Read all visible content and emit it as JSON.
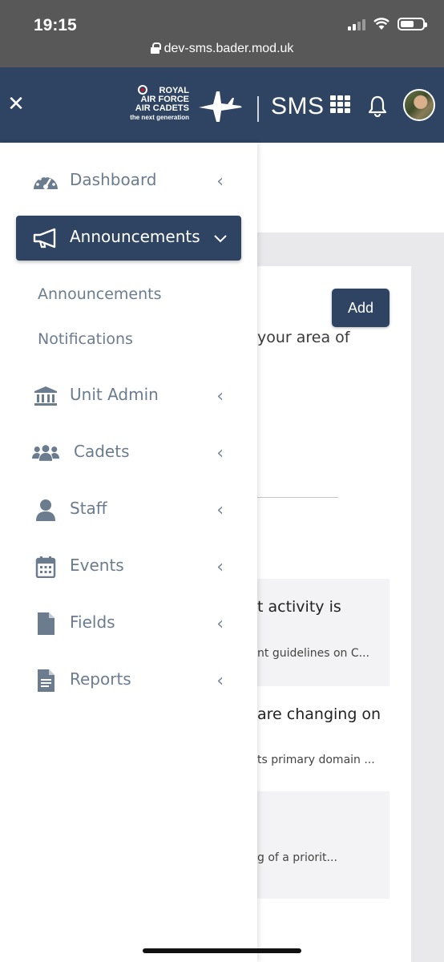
{
  "status_bar": {
    "time": "19:15",
    "url": "dev-sms.bader.mod.uk"
  },
  "header": {
    "brand_lines": [
      "ROYAL",
      "AIR FORCE",
      "AIR CADETS",
      "the next generation"
    ],
    "app_name": "SMS"
  },
  "sidebar": {
    "items": [
      {
        "label": "Dashboard",
        "icon": "dashboard-gauge-icon"
      },
      {
        "label": "Announcements",
        "icon": "megaphone-icon",
        "active": true
      },
      {
        "label": "Unit Admin",
        "icon": "bank-building-icon"
      },
      {
        "label": "Cadets",
        "icon": "users-group-icon"
      },
      {
        "label": "Staff",
        "icon": "user-icon"
      },
      {
        "label": "Events",
        "icon": "calendar-icon"
      },
      {
        "label": "Fields",
        "icon": "file-icon"
      },
      {
        "label": "Reports",
        "icon": "file-text-icon"
      }
    ],
    "sub_items": [
      "Announcements",
      "Notifications"
    ]
  },
  "page": {
    "add_label": "Add",
    "intro_fragment": "your area of",
    "announcements": [
      {
        "title": "t activity is",
        "snippet": "nt guidelines on C..."
      },
      {
        "title": "are changing on",
        "snippet": "ts primary domain ..."
      },
      {
        "title": "",
        "snippet": "g of a priorit..."
      }
    ]
  },
  "colors": {
    "header_bg": "#2e4462",
    "active_nav_bg": "#2e4462",
    "nav_text": "#6b7c8e"
  }
}
